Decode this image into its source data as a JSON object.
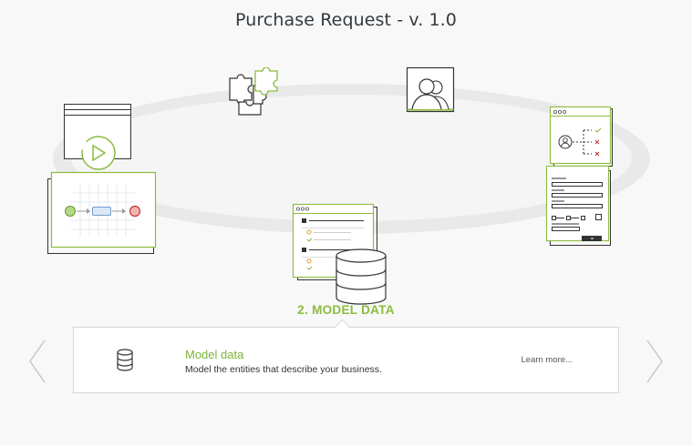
{
  "page": {
    "title": "Purchase Request - v. 1.0"
  },
  "carousel": {
    "active_stage_label": "2. MODEL DATA",
    "stage_icons": [
      "process-diagram-icon",
      "integrations-puzzle-icon",
      "users-icon",
      "forms-icon",
      "data-model-icon"
    ],
    "accent_color": "#8bbc3d"
  },
  "detail_panel": {
    "icon": "database-icon",
    "title": "Model data",
    "description": "Model the entities that describe your business.",
    "link_label": "Learn more..."
  },
  "navigation": {
    "prev_icon": "chevron-left-icon",
    "next_icon": "chevron-right-icon"
  }
}
